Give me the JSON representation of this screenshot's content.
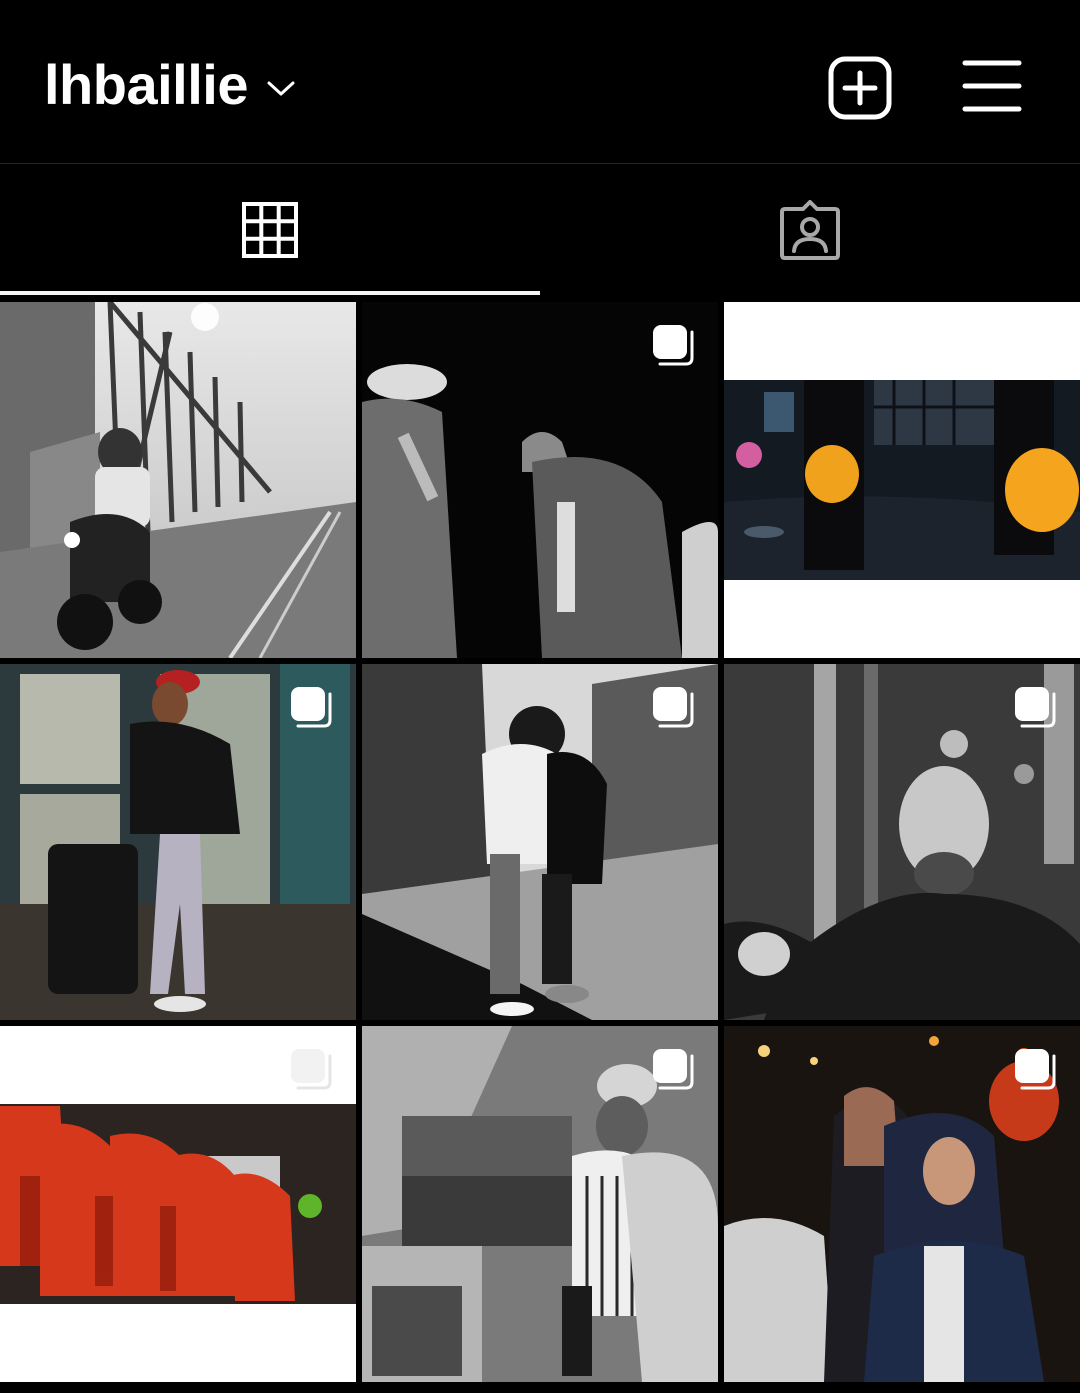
{
  "header": {
    "username": "lhbaillie",
    "chevron_icon": "chevron-down-icon",
    "new_post_icon": "plus-square-icon",
    "menu_icon": "hamburger-menu-icon"
  },
  "tabs": [
    {
      "id": "posts",
      "icon": "grid-icon",
      "active": true
    },
    {
      "id": "tagged",
      "icon": "tagged-person-icon",
      "active": false
    }
  ],
  "posts": [
    {
      "subject": "scooter-on-bridge",
      "multiple": false,
      "color": "grayscale"
    },
    {
      "subject": "street-musicians",
      "multiple": true,
      "color": "grayscale"
    },
    {
      "subject": "orange-balloons",
      "multiple": true,
      "color": "color"
    },
    {
      "subject": "woman-with-suitcase",
      "multiple": true,
      "color": "color"
    },
    {
      "subject": "couple-embrace",
      "multiple": true,
      "color": "grayscale"
    },
    {
      "subject": "man-making-face",
      "multiple": true,
      "color": "grayscale"
    },
    {
      "subject": "red-rebels",
      "multiple": true,
      "color": "color"
    },
    {
      "subject": "kitchen-chef",
      "multiple": true,
      "color": "grayscale"
    },
    {
      "subject": "women-night-market",
      "multiple": true,
      "color": "color"
    }
  ],
  "colors": {
    "background": "#000000",
    "icon": "#ffffff",
    "inactive_icon": "#a8a8a8",
    "tab_indicator": "#f5f5f5"
  }
}
